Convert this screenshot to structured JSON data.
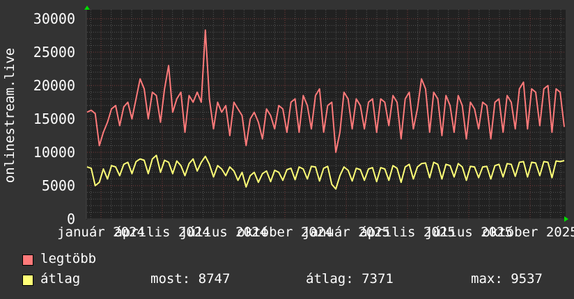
{
  "chart_data": {
    "type": "line",
    "ylabel": "onlinestream.live",
    "ylim": [
      0,
      30000
    ],
    "y_ticks": [
      "0",
      "5000",
      "10000",
      "15000",
      "20000",
      "25000",
      "30000"
    ],
    "x_tick_labels": [
      "január 2024",
      "április 2024",
      "július 2024",
      "október 2024",
      "január 2025",
      "április 2025",
      "július 2025",
      "október 2025"
    ],
    "grid": true,
    "legend_placement": "bottom",
    "series": [
      {
        "name": "legtöbb",
        "color": "#ff7a7a",
        "values": [
          16000,
          16300,
          15800,
          11000,
          13000,
          14500,
          16500,
          17000,
          14000,
          16800,
          17500,
          15000,
          18000,
          21000,
          19500,
          15000,
          19000,
          18500,
          14500,
          19500,
          23000,
          16000,
          18000,
          19000,
          13000,
          18500,
          17500,
          19000,
          17500,
          28300,
          18000,
          13500,
          17500,
          16000,
          17000,
          12500,
          17500,
          16500,
          15500,
          11000,
          15000,
          16000,
          14500,
          12000,
          16500,
          15500,
          13500,
          17000,
          16500,
          13000,
          17500,
          18000,
          13000,
          18500,
          17000,
          13500,
          18500,
          19500,
          13000,
          17000,
          17500,
          10000,
          13000,
          19000,
          18000,
          13500,
          18000,
          17000,
          13500,
          17500,
          18000,
          13000,
          18000,
          17500,
          14000,
          18500,
          17500,
          12000,
          18000,
          19000,
          13500,
          16500,
          21000,
          19500,
          13000,
          19000,
          18000,
          12500,
          18500,
          17000,
          13000,
          18500,
          17000,
          12000,
          17500,
          16500,
          13500,
          17500,
          17000,
          12000,
          17500,
          18000,
          13000,
          18500,
          17500,
          13500,
          19500,
          20500,
          13500,
          19500,
          19000,
          14000,
          19500,
          20000,
          13000,
          19500,
          19000,
          13800
        ]
      },
      {
        "name": "átlag",
        "color": "#ffff77",
        "values": [
          7800,
          7600,
          5000,
          5500,
          7500,
          6000,
          8000,
          7800,
          6500,
          8200,
          8500,
          6800,
          8600,
          9000,
          8800,
          6800,
          9000,
          9537,
          7000,
          8800,
          8500,
          6800,
          8700,
          8000,
          6500,
          8300,
          9000,
          7200,
          8500,
          9400,
          8200,
          6300,
          8000,
          7500,
          6500,
          7800,
          7200,
          5800,
          7000,
          4800,
          6500,
          7000,
          5500,
          6800,
          7200,
          5600,
          7300,
          7000,
          5800,
          7400,
          7600,
          5900,
          7800,
          7500,
          6000,
          7900,
          7800,
          5700,
          7600,
          7900,
          5200,
          4500,
          6500,
          7800,
          7300,
          5700,
          7600,
          7400,
          5800,
          7500,
          7700,
          5600,
          7700,
          7500,
          5800,
          8000,
          7600,
          5500,
          7800,
          8200,
          6000,
          7800,
          8300,
          8400,
          6200,
          8500,
          8200,
          6000,
          8200,
          8000,
          6300,
          8300,
          7800,
          5800,
          7900,
          7800,
          6200,
          7800,
          7900,
          6000,
          8000,
          8200,
          6300,
          8300,
          8200,
          6400,
          8500,
          8600,
          6300,
          8500,
          8400,
          6500,
          8600,
          8500,
          6200,
          8700,
          8600,
          8747
        ]
      }
    ]
  },
  "legend": {
    "items": [
      {
        "label": "legtöbb",
        "color": "#ff7a7a"
      },
      {
        "label": "átlag",
        "color": "#ffff77"
      }
    ],
    "stats": {
      "now": "most: 8747",
      "avg": "átlag: 7371",
      "max": "max: 9537"
    }
  }
}
